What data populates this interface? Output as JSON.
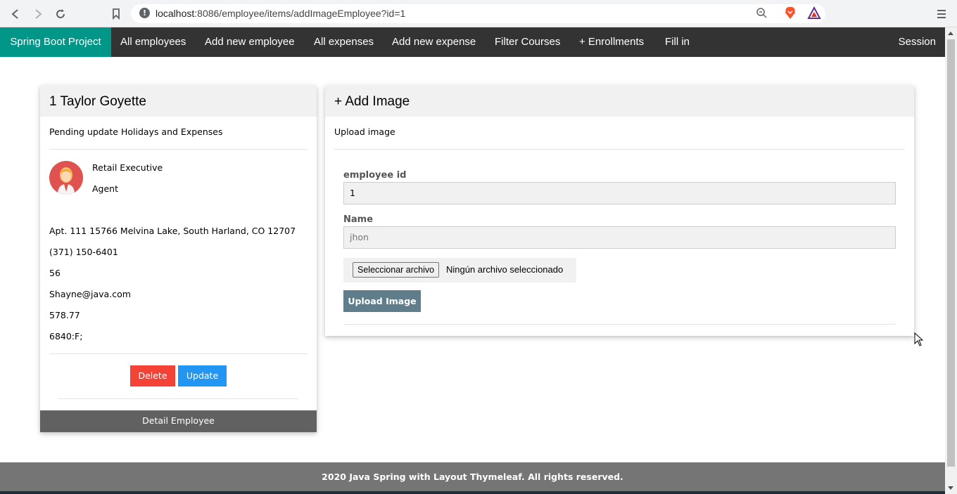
{
  "browser": {
    "url_host": "localhost",
    "url_rest": ":8086/employee/items/addImageEmployee?id=1"
  },
  "navbar": {
    "brand": "Spring Boot Project",
    "items": [
      "All employees",
      "Add new employee",
      "All expenses",
      "Add new expense",
      "Filter Courses",
      "+ Enrollments",
      "Fill in"
    ],
    "session": "Session"
  },
  "employee_card": {
    "title": "1 Taylor Goyette",
    "subtitle": "Pending update Holidays and Expenses",
    "role": "Retail Executive",
    "position": "Agent",
    "address": "Apt. 111 15766 Melvina Lake, South Harland, CO 12707",
    "phone": "(371) 150-6401",
    "age": "56",
    "email": "Shayne@java.com",
    "salary": "578.77",
    "code": "6840:F;",
    "delete_label": "Delete",
    "update_label": "Update",
    "footer": "Detail Employee"
  },
  "image_card": {
    "title": "+ Add Image",
    "subtitle": "Upload image",
    "employee_id_label": "employee id",
    "employee_id_value": "1",
    "name_label": "Name",
    "name_placeholder": "jhon",
    "file_button": "Seleccionar archivo",
    "file_status": "Ningún archivo seleccionado",
    "upload_label": "Upload Image"
  },
  "footer": {
    "text": "2020 Java Spring with Layout Thymeleaf. All rights reserved."
  },
  "colors": {
    "brand": "#009688",
    "navbar": "#333333",
    "delete": "#f44336",
    "update": "#2196f3",
    "upload": "#607d8b",
    "footer": "#757575"
  }
}
